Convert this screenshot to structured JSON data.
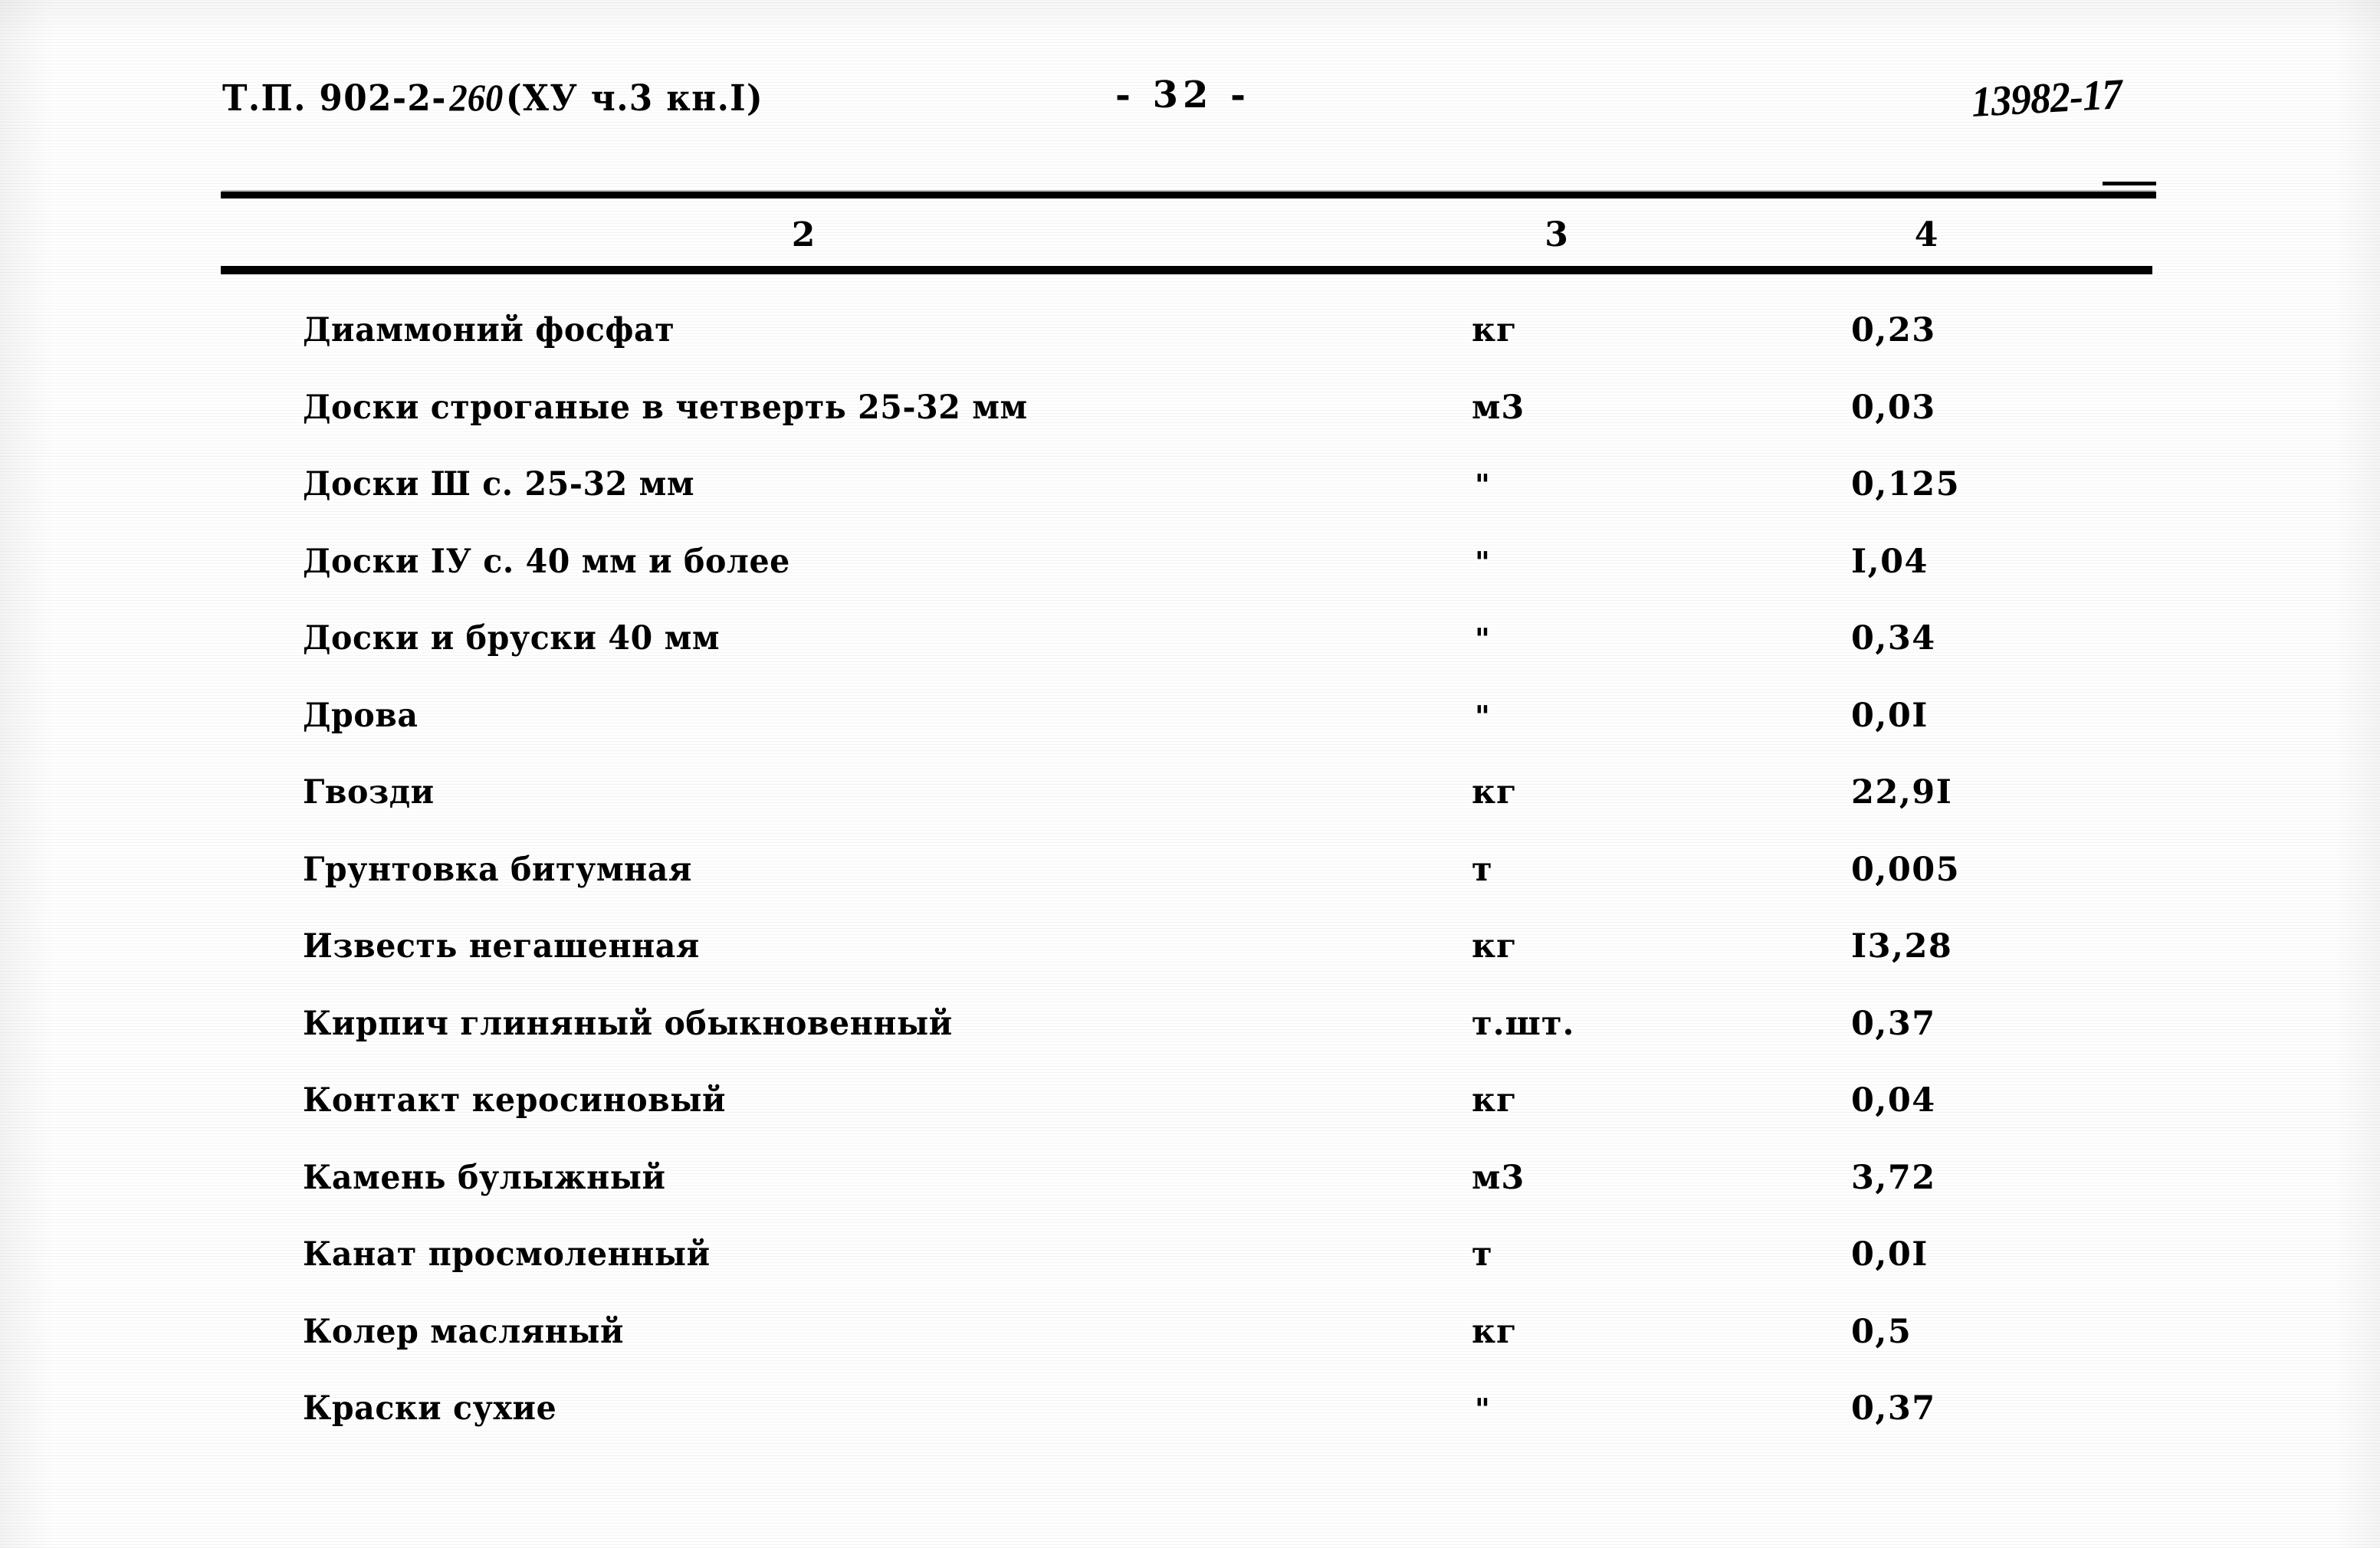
{
  "header": {
    "doc_code_prefix": "Т.П. 902-2-",
    "doc_code_handwritten": "260",
    "doc_code_suffix": "(ХУ ч.3 кн.I)",
    "page_number": "- 32 -",
    "archive_mark": "13982-17"
  },
  "table": {
    "column_headers": [
      "2",
      "3",
      "4"
    ],
    "rows": [
      {
        "name": "Диаммоний фосфат",
        "unit": "кг",
        "value": "0,23"
      },
      {
        "name": "Доски строганые в четверть 25-32 мм",
        "unit": "м3",
        "value": "0,03"
      },
      {
        "name": "Доски Ш с. 25-32 мм",
        "unit": "\"",
        "value": "0,125"
      },
      {
        "name": "Доски IУ с. 40 мм и более",
        "unit": "\"",
        "value": "I,04"
      },
      {
        "name": "Доски и бруски 40 мм",
        "unit": "\"",
        "value": "0,34"
      },
      {
        "name": "Дрова",
        "unit": "\"",
        "value": "0,0I"
      },
      {
        "name": "Гвозди",
        "unit": "кг",
        "value": "22,9I"
      },
      {
        "name": "Грунтовка битумная",
        "unit": "т",
        "value": "0,005"
      },
      {
        "name": "Известь негашенная",
        "unit": "кг",
        "value": "I3,28"
      },
      {
        "name": "Кирпич глиняный обыкновенный",
        "unit": "т.шт.",
        "value": "0,37"
      },
      {
        "name": "Контакт керосиновый",
        "unit": "кг",
        "value": "0,04"
      },
      {
        "name": "Камень булыжный",
        "unit": "м3",
        "value": "3,72"
      },
      {
        "name": "Канат просмоленный",
        "unit": "т",
        "value": "0,0I"
      },
      {
        "name": "Колер масляный",
        "unit": "кг",
        "value": "0,5"
      },
      {
        "name": "Краски сухие",
        "unit": "\"",
        "value": "0,37"
      }
    ]
  },
  "colors": {
    "ink": "#000000",
    "paper": "#fefefe"
  }
}
